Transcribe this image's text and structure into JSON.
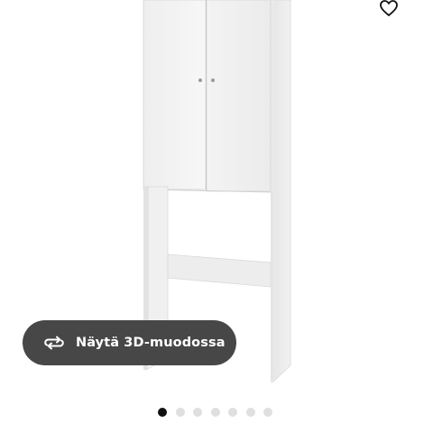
{
  "product": {
    "image_name": "bathroom-cabinet-over-washer"
  },
  "favorite": {
    "icon": "heart-outline-icon"
  },
  "view3d": {
    "label": "Näytä 3D-muodossa",
    "icon": "rotate-3d-icon",
    "background_color": "#474747",
    "text_color": "#ffffff"
  },
  "carousel": {
    "total": 7,
    "active_index": 0,
    "active_color": "#111111",
    "inactive_color": "#dfdfdf"
  }
}
